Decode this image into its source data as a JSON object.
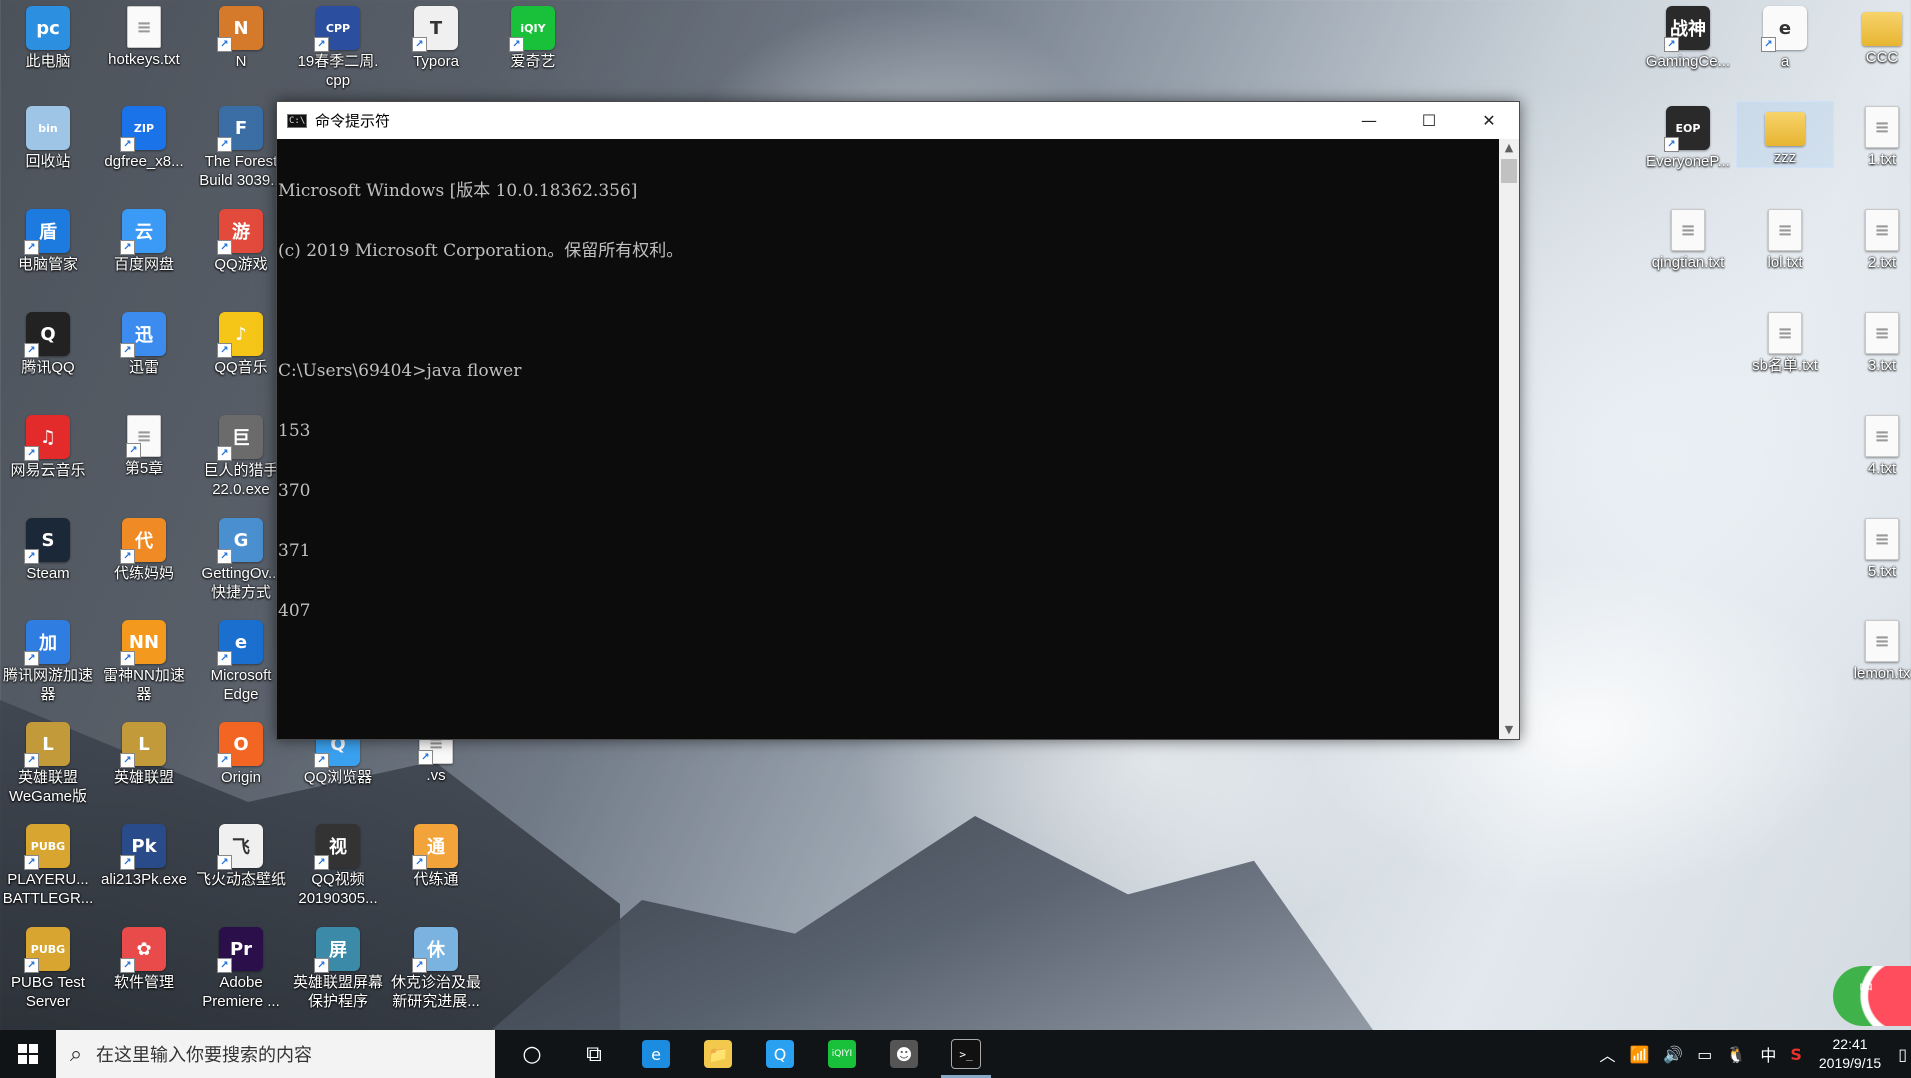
{
  "desktop": {
    "icons": [
      {
        "label": "此电脑",
        "glyph": "pc",
        "color": "#2d8fe0"
      },
      {
        "label": "hotkeys.txt",
        "glyph": "txt",
        "color": "#fafafa"
      },
      {
        "label": "N",
        "glyph": "N",
        "color": "#d47a2a"
      },
      {
        "label": "19春季二周.\ncpp",
        "glyph": "CPP",
        "color": "#2b4f9e"
      },
      {
        "label": "Typora",
        "glyph": "T",
        "color": "#f0f0f0"
      },
      {
        "label": "爱奇艺",
        "glyph": "iQIYI",
        "color": "#19c03a"
      },
      {
        "label": "回收站",
        "glyph": "bin",
        "color": "#9ec4e6"
      },
      {
        "label": "dgfree_x8...",
        "glyph": "ZIP",
        "color": "#1a73e8"
      },
      {
        "label": "The Forest\nBuild 3039...",
        "glyph": "F",
        "color": "#3a6ea5"
      },
      {
        "label": "电脑管家",
        "glyph": "盾",
        "color": "#1d7be0"
      },
      {
        "label": "百度网盘",
        "glyph": "云",
        "color": "#3a9af5"
      },
      {
        "label": "QQ游戏",
        "glyph": "游",
        "color": "#e24a3b"
      },
      {
        "label": "腾讯QQ",
        "glyph": "Q",
        "color": "#222"
      },
      {
        "label": "迅雷",
        "glyph": "迅",
        "color": "#3c8cf0"
      },
      {
        "label": "QQ音乐",
        "glyph": "♪",
        "color": "#f5c518"
      },
      {
        "label": "网易云音乐",
        "glyph": "♫",
        "color": "#e32b2b"
      },
      {
        "label": "第5章",
        "glyph": "doc",
        "color": "#fafafa"
      },
      {
        "label": "巨人的猎手\n22.0.exe",
        "glyph": "巨",
        "color": "#6b6b6b"
      },
      {
        "label": "Steam",
        "glyph": "S",
        "color": "#1b2838"
      },
      {
        "label": "代练妈妈",
        "glyph": "代",
        "color": "#f08a24"
      },
      {
        "label": "GettingOv...\n快捷方式",
        "glyph": "G",
        "color": "#4a8fcf"
      },
      {
        "label": "腾讯网游加速\n器",
        "glyph": "加",
        "color": "#2f7de0"
      },
      {
        "label": "雷神NN加速\n器",
        "glyph": "NN",
        "color": "#f39a1e"
      },
      {
        "label": "Microsoft\nEdge",
        "glyph": "e",
        "color": "#1b6fcf"
      },
      {
        "label": "英雄联盟\nWeGame版",
        "glyph": "L",
        "color": "#c29a3a"
      },
      {
        "label": "英雄联盟",
        "glyph": "L",
        "color": "#c29a3a"
      },
      {
        "label": "Origin",
        "glyph": "O",
        "color": "#f26522"
      },
      {
        "label": "QQ浏览器",
        "glyph": "Q",
        "color": "#3aa1f0"
      },
      {
        "label": ".vs",
        "glyph": "doc",
        "color": "#fafafa"
      },
      {
        "label": "PLAYERU...\nBATTLEGR...",
        "glyph": "PUBG",
        "color": "#d7a530"
      },
      {
        "label": "ali213Pk.exe",
        "glyph": "Pk",
        "color": "#2a4b8a"
      },
      {
        "label": "飞火动态壁纸",
        "glyph": "飞",
        "color": "#f0f0f0"
      },
      {
        "label": "QQ视频\n20190305...",
        "glyph": "视",
        "color": "#333"
      },
      {
        "label": "代练通",
        "glyph": "通",
        "color": "#f2a33a"
      },
      {
        "label": "PUBG Test\nServer",
        "glyph": "PUBG",
        "color": "#d7a530"
      },
      {
        "label": "软件管理",
        "glyph": "✿",
        "color": "#e94b4b"
      },
      {
        "label": "Adobe\nPremiere ...",
        "glyph": "Pr",
        "color": "#2a0f4a"
      },
      {
        "label": "英雄联盟屏幕\n保护程序",
        "glyph": "屏",
        "color": "#3a8aa8"
      },
      {
        "label": "休克诊治及最\n新研究进展...",
        "glyph": "休",
        "color": "#7ab3e0"
      },
      {
        "label": "GamingCe...",
        "glyph": "战神",
        "color": "#2a2a2a"
      },
      {
        "label": "a",
        "glyph": "e",
        "color": "#fafafa"
      },
      {
        "label": "CCC",
        "glyph": "folder",
        "color": "#f2c94c"
      },
      {
        "label": "EveryoneP...",
        "glyph": "EOP",
        "color": "#2a2a2a"
      },
      {
        "label": "zzz",
        "glyph": "folder",
        "color": "#f2c94c"
      },
      {
        "label": "1.txt",
        "glyph": "txt",
        "color": "#fafafa"
      },
      {
        "label": "qingtian.txt",
        "glyph": "txt",
        "color": "#fafafa"
      },
      {
        "label": "lol.txt",
        "glyph": "txt",
        "color": "#fafafa"
      },
      {
        "label": "2.txt",
        "glyph": "txt",
        "color": "#fafafa"
      },
      {
        "label": "sb名单.txt",
        "glyph": "txt",
        "color": "#fafafa"
      },
      {
        "label": "3.txt",
        "glyph": "txt",
        "color": "#fafafa"
      },
      {
        "label": "4.txt",
        "glyph": "txt",
        "color": "#fafafa"
      },
      {
        "label": "5.txt",
        "glyph": "txt",
        "color": "#fafafa"
      },
      {
        "label": "lemon.tx",
        "glyph": "txt",
        "color": "#fafafa"
      }
    ]
  },
  "window": {
    "title": "命令提示符",
    "minimize": "—",
    "maximize": "☐",
    "close": "✕",
    "lines": [
      "Microsoft Windows [版本 10.0.18362.356]",
      "(c) 2019 Microsoft Corporation。保留所有权利。",
      "",
      "C:\\Users\\69404>java flower",
      "153",
      "370",
      "371",
      "407"
    ]
  },
  "taskbar": {
    "search_placeholder": "在这里输入你要搜索的内容",
    "apps": [
      {
        "name": "cortana",
        "glyph": "○"
      },
      {
        "name": "task-view",
        "glyph": "⧉"
      },
      {
        "name": "edge",
        "glyph": "e",
        "color": "#1b8ce0"
      },
      {
        "name": "file-explorer",
        "glyph": "📁",
        "color": "#f2c94c"
      },
      {
        "name": "qq-browser",
        "glyph": "Q",
        "color": "#2aa0f0"
      },
      {
        "name": "iqiyi",
        "glyph": "iQIYI",
        "color": "#19c03a"
      },
      {
        "name": "avatar-app",
        "glyph": "☻",
        "color": "#555"
      },
      {
        "name": "cmd",
        "glyph": ">_",
        "color": "#111"
      }
    ],
    "tray": {
      "ime": "中",
      "time": "22:41",
      "date": "2019/9/15"
    }
  },
  "watermelon_badge": "中"
}
